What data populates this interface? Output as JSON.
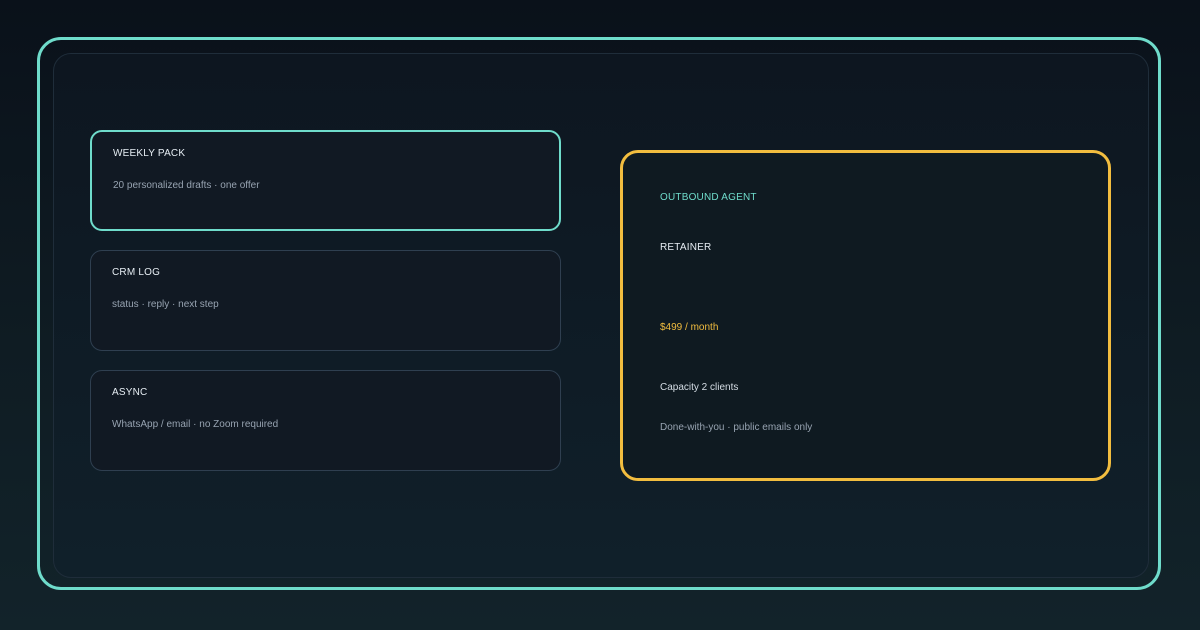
{
  "colors": {
    "accent_teal": "#6fdccb",
    "accent_gold": "#f2bd3f",
    "card_border": "#2f3f50",
    "text_primary": "#e6edf3",
    "text_muted": "#97a3b1"
  },
  "features": [
    {
      "title": "WEEKLY PACK",
      "description": "20 personalized drafts · one offer",
      "highlighted": true
    },
    {
      "title": "CRM LOG",
      "description": "status · reply · next step",
      "highlighted": false
    },
    {
      "title": "ASYNC",
      "description": "WhatsApp / email · no Zoom required",
      "highlighted": false
    }
  ],
  "offer": {
    "eyebrow": "OUTBOUND AGENT",
    "name": "RETAINER",
    "price": "$499 / month",
    "capacity": "Capacity 2 clients",
    "note": "Done-with-you · public emails only"
  }
}
